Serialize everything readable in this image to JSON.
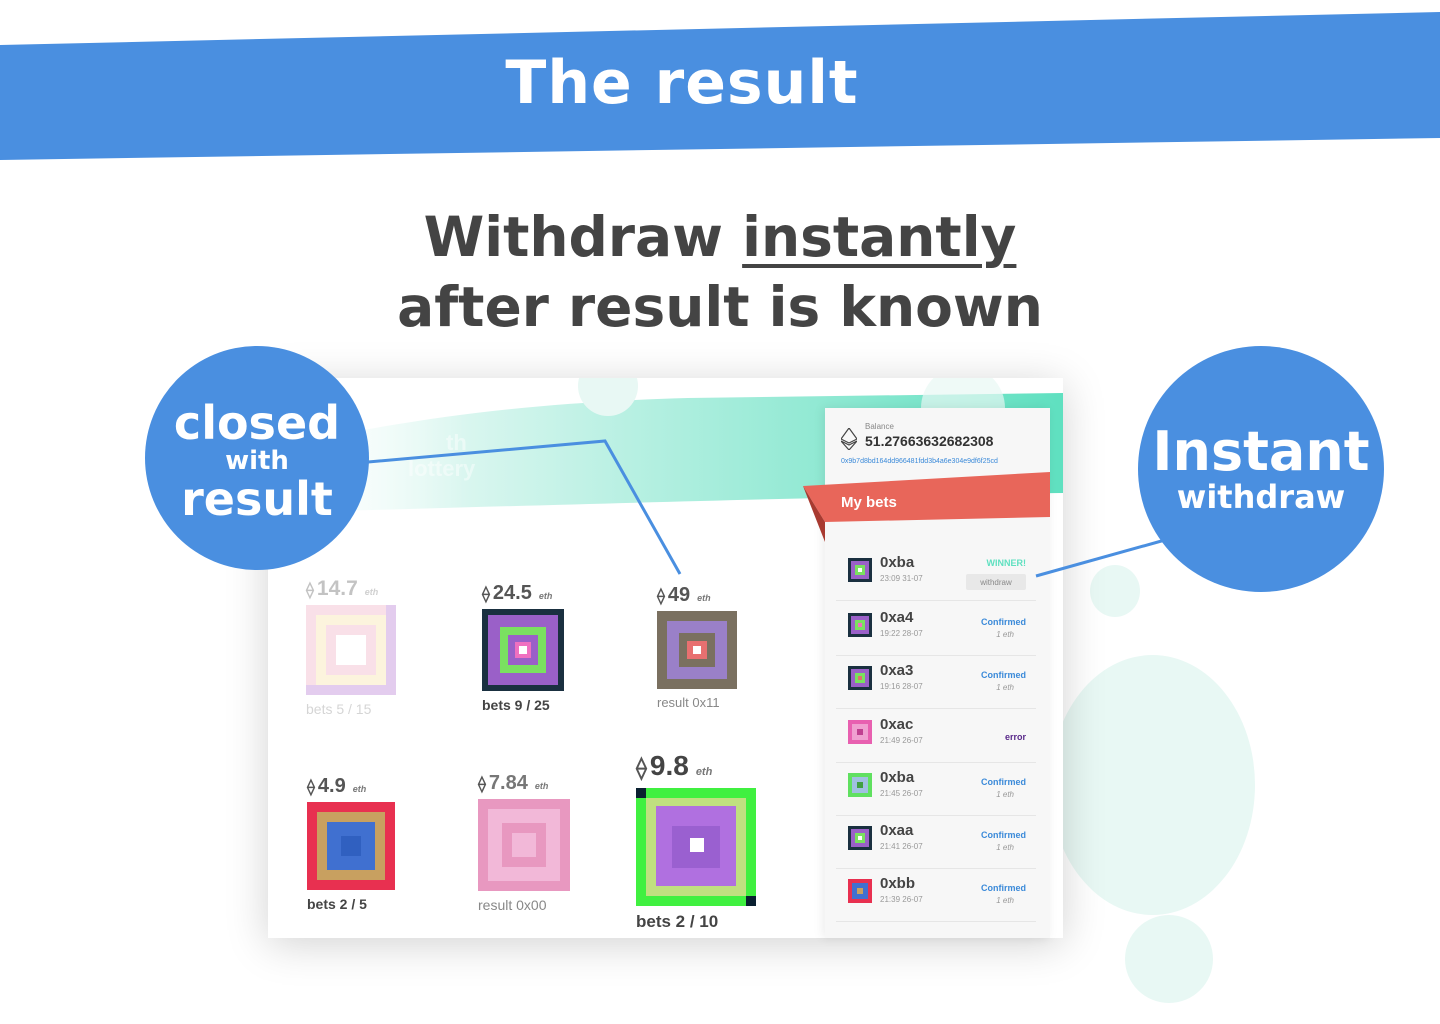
{
  "banner": {
    "title": "The result",
    "color": "#4a8fe0"
  },
  "headline": {
    "line1_prefix": "Withdraw ",
    "line1_underlined": "instantly",
    "line2": "after result is known"
  },
  "callouts": {
    "left": {
      "line1": "closed",
      "line2": "with",
      "line3": "result"
    },
    "right": {
      "line1": "Instant",
      "line2": "withdraw"
    }
  },
  "app": {
    "header_ghost": {
      "line1": "th",
      "line2": "lottery"
    },
    "currency_unit": "eth",
    "lotteries": [
      {
        "amount": "14.7",
        "label": "bets 5 / 15",
        "faded": true
      },
      {
        "amount": "24.5",
        "label": "bets 9 / 25",
        "faded": false
      },
      {
        "amount": "49",
        "label": "result 0x11",
        "faded": false
      },
      {
        "amount": "4.9",
        "label": "bets 2 / 5",
        "faded": false
      },
      {
        "amount": "7.84",
        "label": "result 0x00",
        "faded": false
      },
      {
        "amount": "9.8",
        "label": "bets 2 / 10",
        "faded": false
      }
    ],
    "sidebar": {
      "balance_caption": "Balance",
      "balance_value": "51.27663632682308",
      "address": "0x9b7d8bd164dd966481fdd3b4a6e304e9df6f25cd",
      "my_bets_label": "My bets",
      "bets": [
        {
          "id": "0xba",
          "time": "23:09 31-07",
          "status": "WINNER!",
          "action": "withdraw"
        },
        {
          "id": "0xa4",
          "time": "19:22 28-07",
          "status": "Confirmed",
          "sub": "1 eth"
        },
        {
          "id": "0xa3",
          "time": "19:16 28-07",
          "status": "Confirmed",
          "sub": "1 eth"
        },
        {
          "id": "0xac",
          "time": "21:49 26-07",
          "status": "error"
        },
        {
          "id": "0xba",
          "time": "21:45 26-07",
          "status": "Confirmed",
          "sub": "1 eth"
        },
        {
          "id": "0xaa",
          "time": "21:41 26-07",
          "status": "Confirmed",
          "sub": "1 eth"
        },
        {
          "id": "0xbb",
          "time": "21:39 26-07",
          "status": "Confirmed",
          "sub": "1 eth"
        }
      ]
    }
  },
  "colors": {
    "accent": "#4a8fe0",
    "teal": "#5fe0c0",
    "ribbon": "#e8665a",
    "link": "#3b8ad9"
  }
}
